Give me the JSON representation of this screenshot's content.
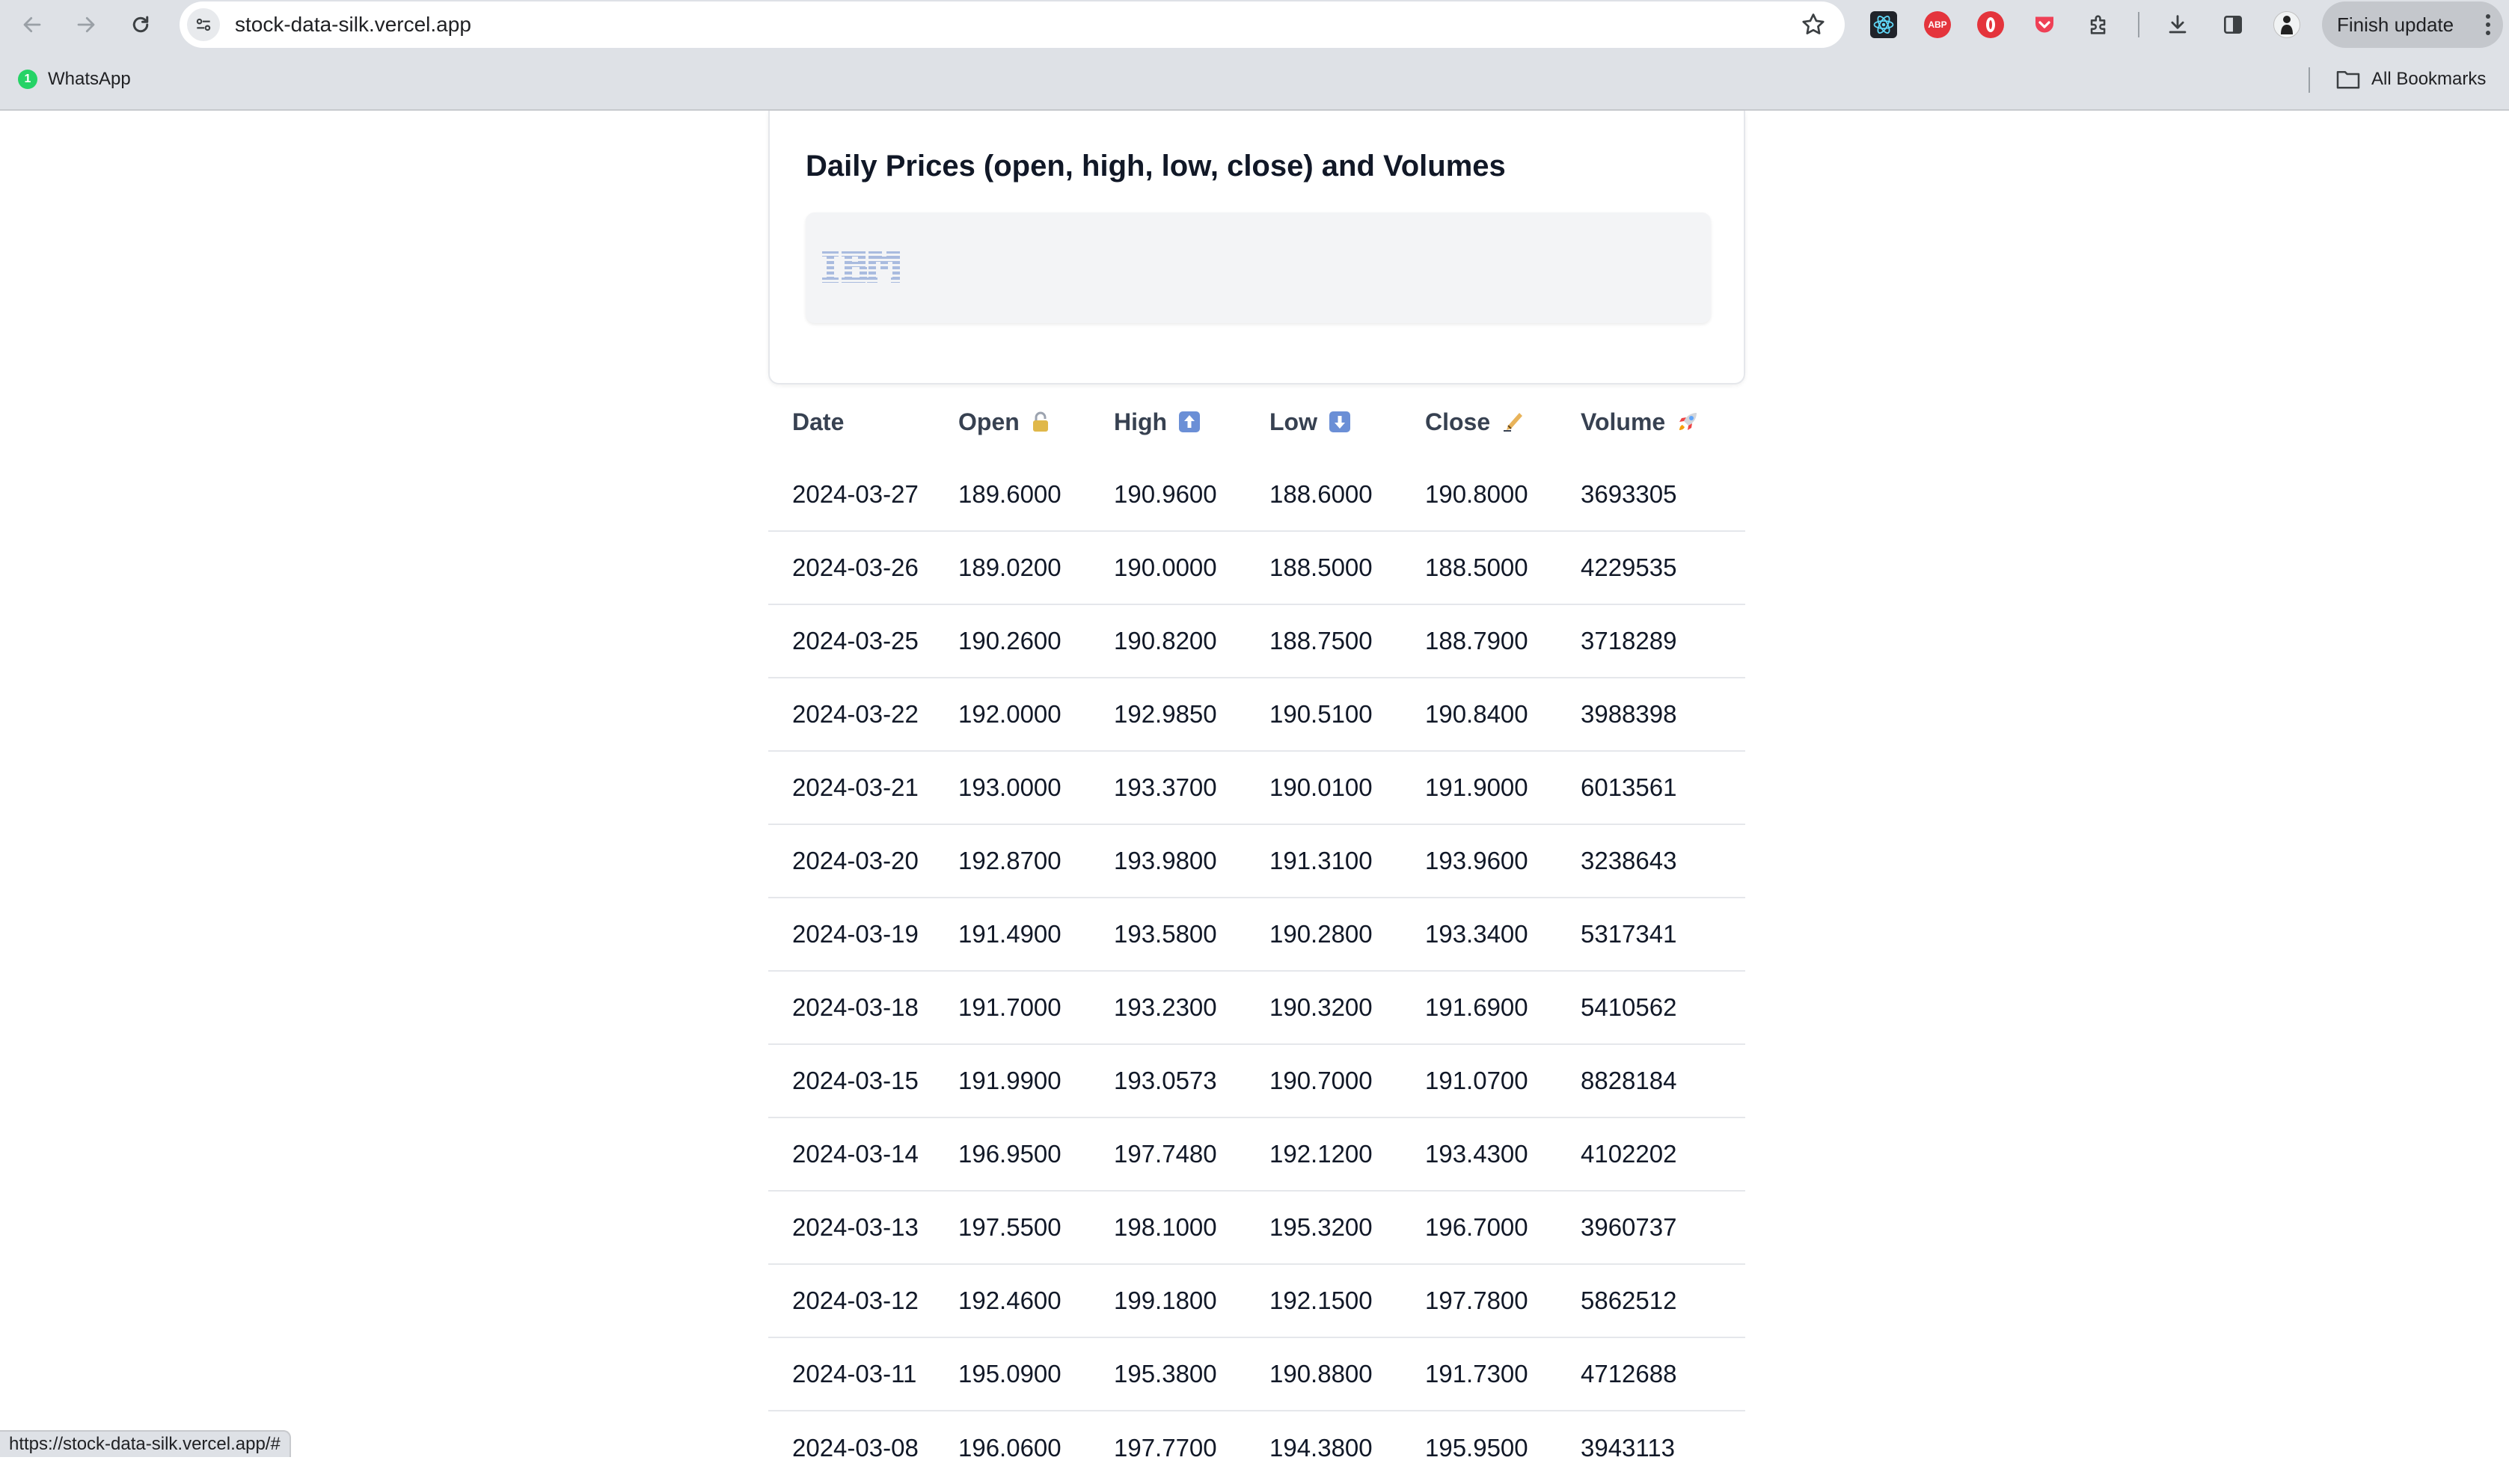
{
  "browser": {
    "url": "stock-data-silk.vercel.app",
    "finish_update_label": "Finish update",
    "bookmarks": [
      {
        "label": "WhatsApp",
        "badge": "1"
      }
    ],
    "all_bookmarks_label": "All Bookmarks",
    "status_url": "https://stock-data-silk.vercel.app/#",
    "extensions": [
      "react-devtools-icon",
      "adblock-plus-icon",
      "opera-icon",
      "pocket-icon",
      "puzzle-icon"
    ]
  },
  "card": {
    "title": "Daily Prices (open, high, low, close) and Volumes",
    "logo_text": "IBM",
    "logo_color": "#5a7fc7"
  },
  "table": {
    "headers": {
      "date": "Date",
      "open": "Open",
      "high": "High",
      "low": "Low",
      "close": "Close",
      "volume": "Volume"
    },
    "header_icons": {
      "open": "lock-icon",
      "high": "up-arrow-icon",
      "low": "down-arrow-icon",
      "close": "writing-hand-icon",
      "volume": "rocket-icon"
    },
    "rows": [
      {
        "date": "2024-03-27",
        "open": "189.6000",
        "high": "190.9600",
        "low": "188.6000",
        "close": "190.8000",
        "volume": "3693305"
      },
      {
        "date": "2024-03-26",
        "open": "189.0200",
        "high": "190.0000",
        "low": "188.5000",
        "close": "188.5000",
        "volume": "4229535"
      },
      {
        "date": "2024-03-25",
        "open": "190.2600",
        "high": "190.8200",
        "low": "188.7500",
        "close": "188.7900",
        "volume": "3718289"
      },
      {
        "date": "2024-03-22",
        "open": "192.0000",
        "high": "192.9850",
        "low": "190.5100",
        "close": "190.8400",
        "volume": "3988398"
      },
      {
        "date": "2024-03-21",
        "open": "193.0000",
        "high": "193.3700",
        "low": "190.0100",
        "close": "191.9000",
        "volume": "6013561"
      },
      {
        "date": "2024-03-20",
        "open": "192.8700",
        "high": "193.9800",
        "low": "191.3100",
        "close": "193.9600",
        "volume": "3238643"
      },
      {
        "date": "2024-03-19",
        "open": "191.4900",
        "high": "193.5800",
        "low": "190.2800",
        "close": "193.3400",
        "volume": "5317341"
      },
      {
        "date": "2024-03-18",
        "open": "191.7000",
        "high": "193.2300",
        "low": "190.3200",
        "close": "191.6900",
        "volume": "5410562"
      },
      {
        "date": "2024-03-15",
        "open": "191.9900",
        "high": "193.0573",
        "low": "190.7000",
        "close": "191.0700",
        "volume": "8828184"
      },
      {
        "date": "2024-03-14",
        "open": "196.9500",
        "high": "197.7480",
        "low": "192.1200",
        "close": "193.4300",
        "volume": "4102202"
      },
      {
        "date": "2024-03-13",
        "open": "197.5500",
        "high": "198.1000",
        "low": "195.3200",
        "close": "196.7000",
        "volume": "3960737"
      },
      {
        "date": "2024-03-12",
        "open": "192.4600",
        "high": "199.1800",
        "low": "192.1500",
        "close": "197.7800",
        "volume": "5862512"
      },
      {
        "date": "2024-03-11",
        "open": "195.0900",
        "high": "195.3800",
        "low": "190.8800",
        "close": "191.7300",
        "volume": "4712688"
      },
      {
        "date": "2024-03-08",
        "open": "196.0600",
        "high": "197.7700",
        "low": "194.3800",
        "close": "195.9500",
        "volume": "3943113"
      }
    ]
  }
}
